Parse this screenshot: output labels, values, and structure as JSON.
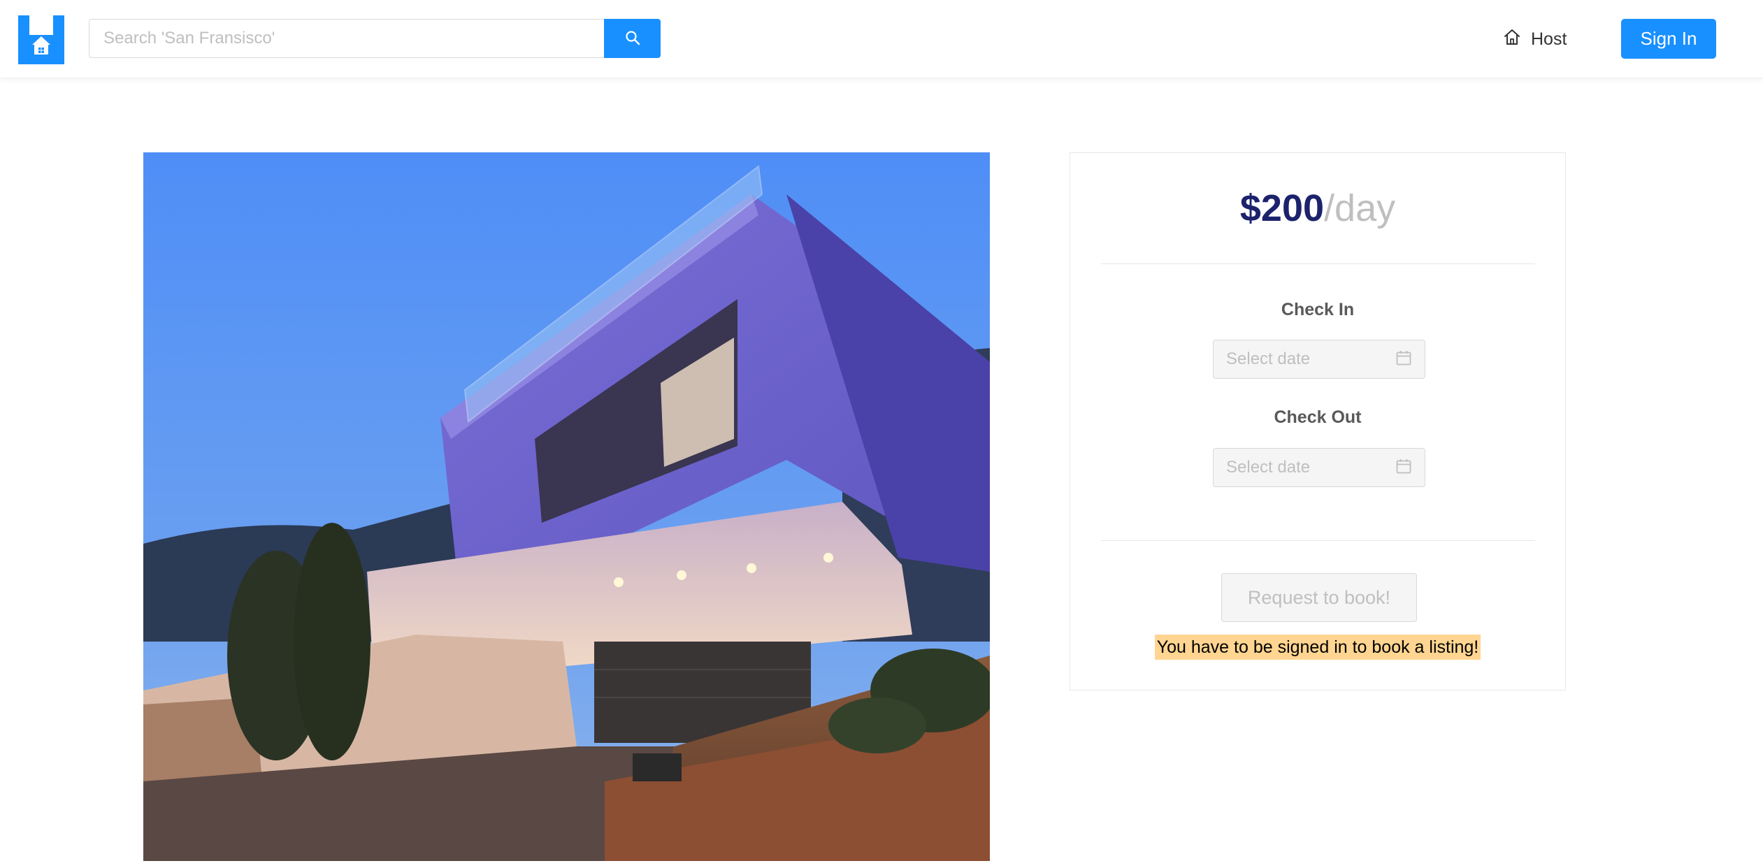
{
  "header": {
    "logo_name": "house-logo",
    "search": {
      "placeholder": "Search 'San Fransisco'",
      "value": "",
      "button_icon": "search-icon"
    },
    "host": {
      "icon": "home-icon",
      "label": "Host"
    },
    "sign_in_label": "Sign In"
  },
  "listing": {
    "image_alt": "Modern house at dusk"
  },
  "booking": {
    "price": "$200",
    "price_unit": "/day",
    "check_in": {
      "label": "Check In",
      "placeholder": "Select date",
      "icon": "calendar-icon"
    },
    "check_out": {
      "label": "Check Out",
      "placeholder": "Select date",
      "icon": "calendar-icon"
    },
    "request_label": "Request to book!",
    "warning": "You have to be signed in to book a listing!"
  },
  "colors": {
    "primary": "#1890ff",
    "price": "#1d226c",
    "warning_bg": "#ffd591"
  }
}
